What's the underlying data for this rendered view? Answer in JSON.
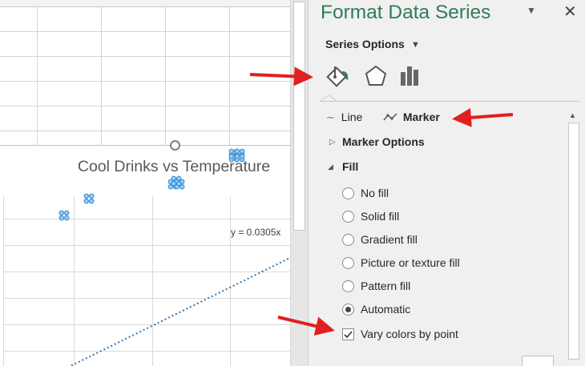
{
  "chart": {
    "title": "Cool Drinks vs Temperature",
    "trendline_equation": "y = 0.0305x"
  },
  "pane": {
    "title": "Format Data Series",
    "dropdown_icon": "caret-down-icon",
    "close_icon": "close-icon",
    "series_options_label": "Series Options",
    "tabs": [
      {
        "name": "fill-line",
        "icon": "paint-bucket-icon",
        "selected": true
      },
      {
        "name": "effects",
        "icon": "pentagon-icon",
        "selected": false
      },
      {
        "name": "series-options",
        "icon": "bar-chart-icon",
        "selected": false
      }
    ],
    "subtabs": {
      "line": "Line",
      "marker": "Marker"
    },
    "sections": {
      "marker_options": "Marker Options",
      "fill": "Fill"
    },
    "fill_options": [
      {
        "label": "No fill",
        "selected": false
      },
      {
        "label": "Solid fill",
        "selected": false
      },
      {
        "label": "Gradient fill",
        "selected": false
      },
      {
        "label": "Picture or texture fill",
        "selected": false
      },
      {
        "label": "Pattern fill",
        "selected": false
      },
      {
        "label": "Automatic",
        "selected": true
      }
    ],
    "vary_colors": {
      "label": "Vary colors by point",
      "checked": true
    }
  },
  "colors": {
    "title_green": "#2e7d57",
    "annotation_red": "#e02020",
    "marker_blue": "#3a8fd6",
    "trendline_blue": "#2e75b6"
  }
}
